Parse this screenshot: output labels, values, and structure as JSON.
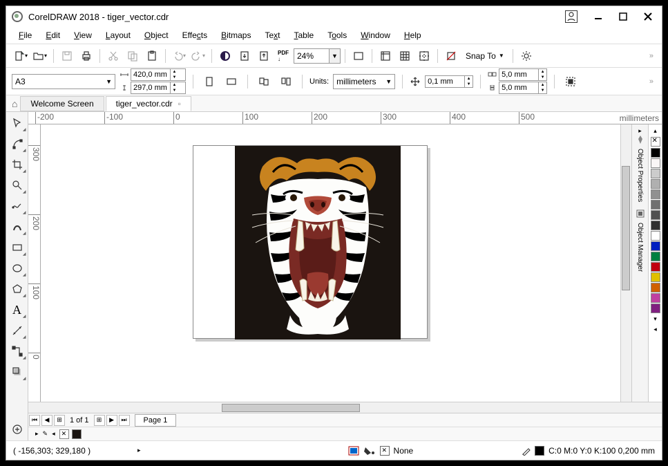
{
  "title": "CorelDRAW 2018 - tiger_vector.cdr",
  "menus": [
    "File",
    "Edit",
    "View",
    "Layout",
    "Object",
    "Effects",
    "Bitmaps",
    "Text",
    "Table",
    "Tools",
    "Window",
    "Help"
  ],
  "toolbar": {
    "zoom": "24%",
    "snap_label": "Snap To"
  },
  "propbar": {
    "page_size": "A3",
    "width": "420,0 mm",
    "height": "297,0 mm",
    "units_label": "Units:",
    "units": "millimeters",
    "nudge": "0,1 mm",
    "dup_x": "5,0 mm",
    "dup_y": "5,0 mm"
  },
  "tabs": {
    "welcome": "Welcome Screen",
    "doc": "tiger_vector.cdr"
  },
  "ruler": {
    "unit": "millimeters",
    "h_ticks": [
      "-200",
      "-100",
      "0",
      "100",
      "200",
      "300",
      "400",
      "500"
    ],
    "v_ticks": [
      "0",
      "100",
      "200",
      "300"
    ]
  },
  "pagenav": {
    "info": "1 of 1",
    "page_tab": "Page 1"
  },
  "dock": [
    "Object Properties",
    "Object Manager"
  ],
  "palette_colors": [
    "#000000",
    "#faf6f6",
    "#cccccc",
    "#b0b0b0",
    "#909090",
    "#707070",
    "#505050",
    "#303030",
    "#ffffff",
    "#0020c0",
    "#008040",
    "#c00010",
    "#e0c000",
    "#d06000",
    "#c040a0",
    "#802080"
  ],
  "status": {
    "coords": "( -156,303; 329,180 )",
    "fill_none": "None",
    "outline": "C:0 M:0 Y:0 K:100  0,200 mm"
  },
  "tool_names": [
    "pick-tool",
    "shape-tool",
    "crop-tool",
    "zoom-tool",
    "freehand-tool",
    "artistic-media-tool",
    "rectangle-tool",
    "ellipse-tool",
    "polygon-tool",
    "text-tool",
    "parallel-dim-tool",
    "connector-tool",
    "drop-shadow-tool"
  ]
}
